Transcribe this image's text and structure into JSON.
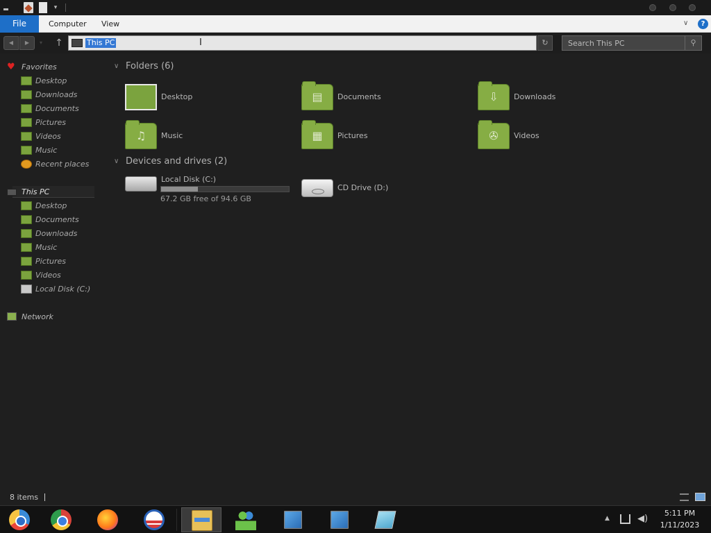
{
  "ribbon": {
    "file": "File",
    "tabs": [
      "Computer",
      "View"
    ]
  },
  "address": {
    "location": "This PC"
  },
  "search": {
    "placeholder": "Search This PC"
  },
  "nav": {
    "favorites": {
      "label": "Favorites",
      "items": [
        "Desktop",
        "Downloads",
        "Documents",
        "Pictures",
        "Videos",
        "Music",
        "Recent places"
      ]
    },
    "this_pc": {
      "label": "This PC",
      "items": [
        "Desktop",
        "Documents",
        "Downloads",
        "Music",
        "Pictures",
        "Videos",
        "Local Disk (C:)"
      ]
    },
    "network": {
      "label": "Network"
    }
  },
  "main": {
    "folders_header": "Folders (6)",
    "folders": [
      "Desktop",
      "Documents",
      "Downloads",
      "Music",
      "Pictures",
      "Videos"
    ],
    "devices_header": "Devices and drives (2)",
    "drives": [
      {
        "name": "Local Disk (C:)",
        "free_text": "67.2 GB free of 94.6 GB",
        "used_fraction": 0.29
      },
      {
        "name": "CD Drive (D:)"
      }
    ]
  },
  "status": {
    "items_count": "8 items"
  },
  "clock": {
    "time": "5:11 PM",
    "date": "1/11/2023"
  },
  "colors": {
    "file_tab": "#1e6fc8",
    "folder_green": "#86ad44",
    "selection": "#3478d4"
  }
}
